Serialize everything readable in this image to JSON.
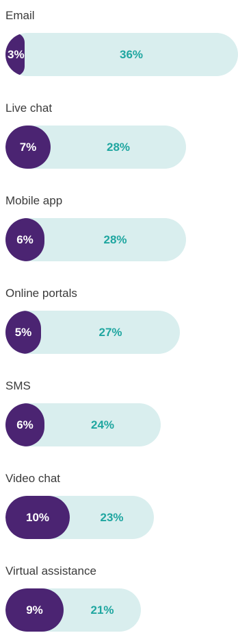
{
  "chart_data": {
    "type": "bar",
    "categories": [
      "Email",
      "Live chat",
      "Mobile app",
      "Online portals",
      "SMS",
      "Video chat",
      "Virtual assistance"
    ],
    "series": [
      {
        "values": [
          3,
          7,
          6,
          5,
          6,
          10,
          9
        ]
      },
      {
        "values": [
          36,
          28,
          28,
          27,
          24,
          23,
          21
        ]
      }
    ],
    "value_labels": [
      [
        "3%",
        "7%",
        "6%",
        "5%",
        "6%",
        "10%",
        "9%"
      ],
      [
        "36%",
        "28%",
        "28%",
        "27%",
        "24%",
        "23%",
        "21%"
      ]
    ],
    "colors": {
      "inner": "#4b2472",
      "outer": "#d9eeee",
      "outer_text": "#1fa6a0",
      "inner_text": "#ffffff",
      "label_text": "#3a3a3a"
    },
    "orientation": "horizontal",
    "grid": false,
    "legend": "none"
  }
}
